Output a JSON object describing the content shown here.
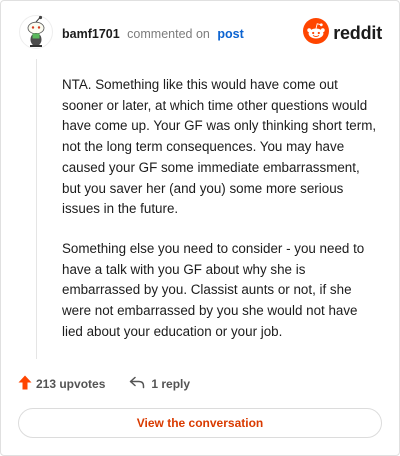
{
  "comment": {
    "username": "bamf1701",
    "action_text": "commented on",
    "target_link": "post",
    "paragraphs": [
      "NTA. Something like this would have come out sooner or later, at which time other questions would have come up. Your GF was only thinking short term, not the long term consequences. You may have caused your GF some immediate embarrassment, but you saver her (and you) some more serious issues in the future.",
      "Something else you need to consider - you need to have a talk with you GF about why she is embarrassed by you. Classist aunts or not, if she were not embarrassed by you she would not have lied about your education or your job."
    ]
  },
  "brand": {
    "name": "reddit",
    "icon": "reddit-snoo-icon",
    "color": "#ff4500"
  },
  "footer": {
    "upvotes_label": "213 upvotes",
    "upvote_icon": "upvote-arrow-icon",
    "reply_label": "1 reply",
    "reply_icon": "reply-arrow-icon",
    "cta_label": "View the conversation"
  },
  "colors": {
    "accent": "#ff4500",
    "cta_text": "#d93a00",
    "link": "#0b63d1",
    "muted": "#7c7c7c"
  }
}
